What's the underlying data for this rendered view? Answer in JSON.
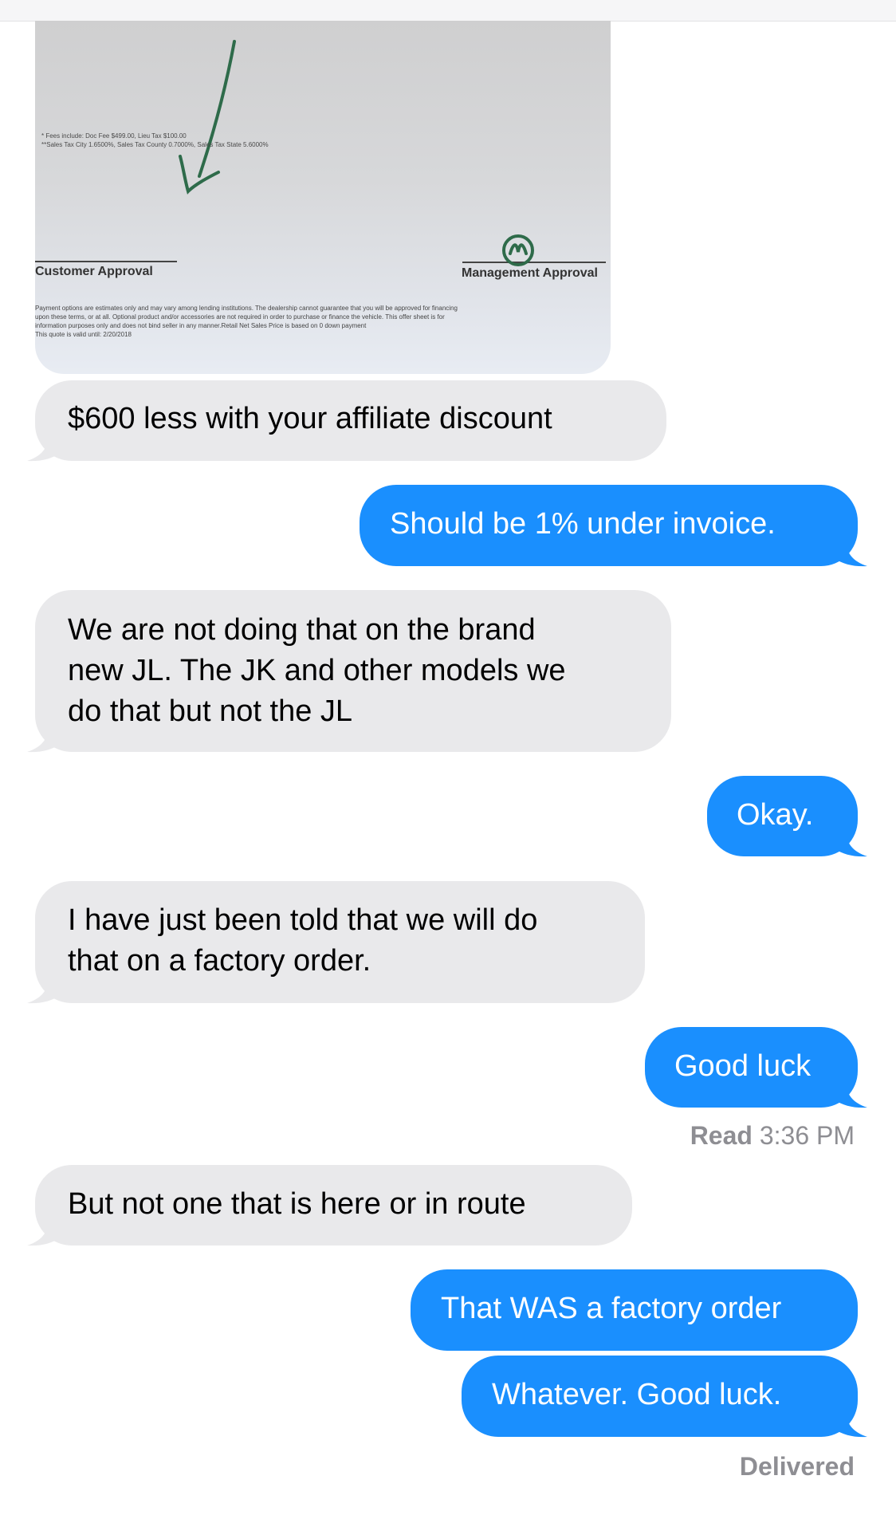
{
  "attachment": {
    "fees_line1": "* Fees include: Doc Fee $499.00, Lieu Tax $100.00",
    "fees_line2": "**Sales Tax City 1.6500%, Sales Tax County 0.7000%, Sales Tax State 5.6000%",
    "customer_approval": "Customer Approval",
    "management_approval": "Management Approval",
    "fine_print": "Payment options are estimates only and may vary among lending institutions. The dealership cannot guarantee that you will be approved for financing\nupon these terms, or at all. Optional product and/or accessories are not required in order to purchase or finance the vehicle. This offer sheet is for\ninformation purposes only and does not bind seller in any manner.Retail Net Sales Price is based on 0 down payment\nThis quote is valid until: 2/20/2018",
    "pen_color": "#2e6b4a"
  },
  "messages": [
    {
      "side": "received",
      "lines": [
        "$600 less with your affiliate discount"
      ]
    },
    {
      "side": "sent",
      "lines": [
        "Should be 1% under invoice."
      ]
    },
    {
      "side": "received",
      "lines": [
        "We are not doing that on the brand",
        "new JL. The JK and other models we",
        "do that but not the JL"
      ]
    },
    {
      "side": "sent",
      "lines": [
        "Okay."
      ]
    },
    {
      "side": "received",
      "lines": [
        "I have just been told that we will do",
        "that on a factory order."
      ]
    },
    {
      "side": "sent",
      "lines": [
        "Good luck"
      ]
    },
    {
      "side": "received",
      "lines": [
        "But not one that is here or in route"
      ]
    },
    {
      "side": "sent",
      "lines": [
        "That WAS a factory order"
      ]
    },
    {
      "side": "sent",
      "lines": [
        "Whatever. Good luck."
      ]
    }
  ],
  "read_receipt": {
    "label": "Read",
    "time": "3:36 PM"
  },
  "delivered_status": "Delivered",
  "colors": {
    "sent_bubble": "#1a8ffe",
    "received_bubble": "#e9e9eb",
    "meta_text": "#8e8e93"
  }
}
